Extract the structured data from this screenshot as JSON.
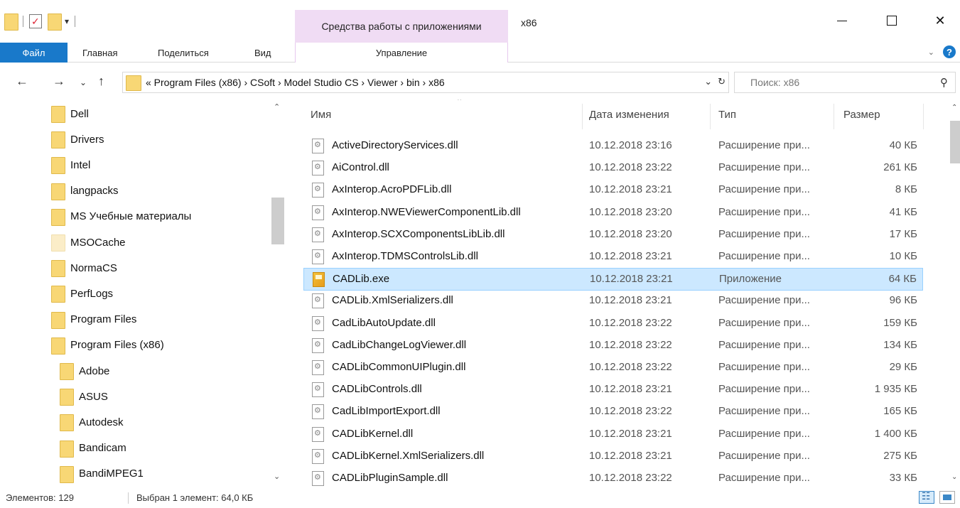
{
  "window": {
    "title": "x86",
    "tool_group_label": "Средства работы с приложениями"
  },
  "ribbon": {
    "tabs": [
      "Файл",
      "Главная",
      "Поделиться",
      "Вид"
    ],
    "context_tab": "Управление"
  },
  "address": {
    "path_text": "«  Program Files (x86)  ›  CSoft  ›  Model Studio CS  ›  Viewer  ›  bin  ›  x86",
    "search_placeholder": "Поиск: x86"
  },
  "tree": [
    {
      "label": "Dell",
      "indent": 0,
      "pale": false
    },
    {
      "label": "Drivers",
      "indent": 0,
      "pale": false
    },
    {
      "label": "Intel",
      "indent": 0,
      "pale": false
    },
    {
      "label": "langpacks",
      "indent": 0,
      "pale": false
    },
    {
      "label": "MS Учебные материалы",
      "indent": 0,
      "pale": false
    },
    {
      "label": "MSOCache",
      "indent": 0,
      "pale": true
    },
    {
      "label": "NormaCS",
      "indent": 0,
      "pale": false
    },
    {
      "label": "PerfLogs",
      "indent": 0,
      "pale": false
    },
    {
      "label": "Program Files",
      "indent": 0,
      "pale": false
    },
    {
      "label": "Program Files (x86)",
      "indent": 0,
      "pale": false
    },
    {
      "label": "Adobe",
      "indent": 1,
      "pale": false
    },
    {
      "label": "ASUS",
      "indent": 1,
      "pale": false
    },
    {
      "label": "Autodesk",
      "indent": 1,
      "pale": false
    },
    {
      "label": "Bandicam",
      "indent": 1,
      "pale": false
    },
    {
      "label": "BandiMPEG1",
      "indent": 1,
      "pale": false
    }
  ],
  "columns": {
    "name": "Имя",
    "date": "Дата изменения",
    "type": "Тип",
    "size": "Размер"
  },
  "files": [
    {
      "name": "ActiveDirectoryServices.dll",
      "date": "10.12.2018 23:16",
      "type": "Расширение при...",
      "size": "40 КБ",
      "icon": "dll-icon",
      "selected": false
    },
    {
      "name": "AiControl.dll",
      "date": "10.12.2018 23:22",
      "type": "Расширение при...",
      "size": "261 КБ",
      "icon": "dll-icon",
      "selected": false
    },
    {
      "name": "AxInterop.AcroPDFLib.dll",
      "date": "10.12.2018 23:21",
      "type": "Расширение при...",
      "size": "8 КБ",
      "icon": "dll-icon",
      "selected": false
    },
    {
      "name": "AxInterop.NWEViewerComponentLib.dll",
      "date": "10.12.2018 23:20",
      "type": "Расширение при...",
      "size": "41 КБ",
      "icon": "dll-icon",
      "selected": false
    },
    {
      "name": "AxInterop.SCXComponentsLibLib.dll",
      "date": "10.12.2018 23:20",
      "type": "Расширение при...",
      "size": "17 КБ",
      "icon": "dll-icon",
      "selected": false
    },
    {
      "name": "AxInterop.TDMSControlsLib.dll",
      "date": "10.12.2018 23:21",
      "type": "Расширение при...",
      "size": "10 КБ",
      "icon": "dll-icon",
      "selected": false
    },
    {
      "name": "CADLib.exe",
      "date": "10.12.2018 23:21",
      "type": "Приложение",
      "size": "64 КБ",
      "icon": "exe-icon",
      "selected": true
    },
    {
      "name": "CADLib.XmlSerializers.dll",
      "date": "10.12.2018 23:21",
      "type": "Расширение при...",
      "size": "96 КБ",
      "icon": "dll-icon",
      "selected": false
    },
    {
      "name": "CadLibAutoUpdate.dll",
      "date": "10.12.2018 23:22",
      "type": "Расширение при...",
      "size": "159 КБ",
      "icon": "dll-icon",
      "selected": false
    },
    {
      "name": "CadLibChangeLogViewer.dll",
      "date": "10.12.2018 23:22",
      "type": "Расширение при...",
      "size": "134 КБ",
      "icon": "dll-icon",
      "selected": false
    },
    {
      "name": "CADLibCommonUIPlugin.dll",
      "date": "10.12.2018 23:22",
      "type": "Расширение при...",
      "size": "29 КБ",
      "icon": "dll-icon",
      "selected": false
    },
    {
      "name": "CADLibControls.dll",
      "date": "10.12.2018 23:21",
      "type": "Расширение при...",
      "size": "1 935 КБ",
      "icon": "dll-icon",
      "selected": false
    },
    {
      "name": "CadLibImportExport.dll",
      "date": "10.12.2018 23:22",
      "type": "Расширение при...",
      "size": "165 КБ",
      "icon": "dll-icon",
      "selected": false
    },
    {
      "name": "CADLibKernel.dll",
      "date": "10.12.2018 23:21",
      "type": "Расширение при...",
      "size": "1 400 КБ",
      "icon": "dll-icon",
      "selected": false
    },
    {
      "name": "CADLibKernel.XmlSerializers.dll",
      "date": "10.12.2018 23:21",
      "type": "Расширение при...",
      "size": "275 КБ",
      "icon": "dll-icon",
      "selected": false
    },
    {
      "name": "CADLibPluginSample.dll",
      "date": "10.12.2018 23:22",
      "type": "Расширение при...",
      "size": "33 КБ",
      "icon": "dll-icon",
      "selected": false
    }
  ],
  "status": {
    "count": "Элементов: 129",
    "selection": "Выбран 1 элемент: 64,0 КБ"
  },
  "colors": {
    "file_tab": "#1979ca",
    "context_tab": "#f0dcf4",
    "selection_bg": "#cce8ff",
    "folder": "#f8d775"
  }
}
